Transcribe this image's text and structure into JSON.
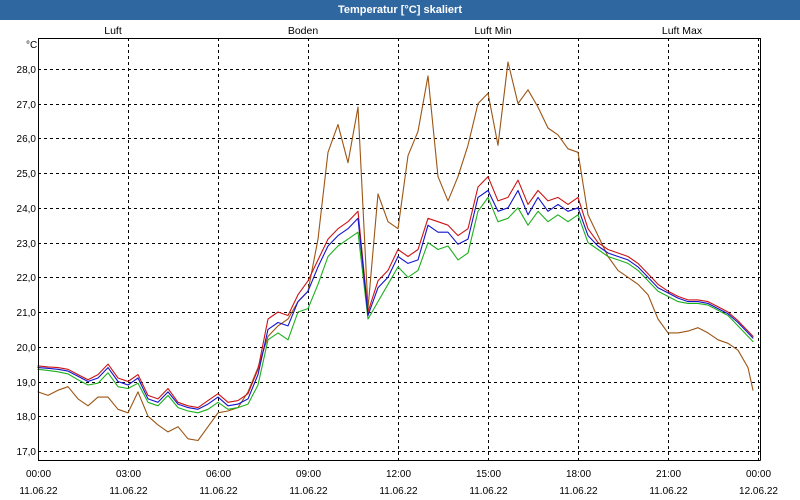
{
  "chart_data": {
    "type": "line",
    "title": "Temperatur [°C] skaliert",
    "ylabel": "°C",
    "ylim": [
      16.74,
      28.89
    ],
    "xlim": [
      "11.06.22 00:00",
      "12.06.22 00:00"
    ],
    "grid": true,
    "legend": "top",
    "yticks": [
      "17,0",
      "18,0",
      "19,0",
      "20,0",
      "21,0",
      "22,0",
      "23,0",
      "24,0",
      "25,0",
      "26,0",
      "27,0",
      "28,0"
    ],
    "xticks": [
      {
        "time": "00:00",
        "date": "11.06.22"
      },
      {
        "time": "03:00",
        "date": "11.06.22"
      },
      {
        "time": "06:00",
        "date": "11.06.22"
      },
      {
        "time": "09:00",
        "date": "11.06.22"
      },
      {
        "time": "12:00",
        "date": "11.06.22"
      },
      {
        "time": "15:00",
        "date": "11.06.22"
      },
      {
        "time": "18:00",
        "date": "11.06.22"
      },
      {
        "time": "21:00",
        "date": "11.06.22"
      },
      {
        "time": "00:00",
        "date": "12.06.22"
      }
    ],
    "x": [
      "11.06.22 00:00",
      "11.06.22 00:20",
      "11.06.22 00:40",
      "11.06.22 01:00",
      "11.06.22 01:20",
      "11.06.22 01:40",
      "11.06.22 02:00",
      "11.06.22 02:20",
      "11.06.22 02:40",
      "11.06.22 03:00",
      "11.06.22 03:20",
      "11.06.22 03:40",
      "11.06.22 04:00",
      "11.06.22 04:20",
      "11.06.22 04:40",
      "11.06.22 05:00",
      "11.06.22 05:20",
      "11.06.22 05:40",
      "11.06.22 06:00",
      "11.06.22 06:20",
      "11.06.22 06:40",
      "11.06.22 07:00",
      "11.06.22 07:20",
      "11.06.22 07:40",
      "11.06.22 08:00",
      "11.06.22 08:20",
      "11.06.22 08:40",
      "11.06.22 09:00",
      "11.06.22 09:20",
      "11.06.22 09:40",
      "11.06.22 10:00",
      "11.06.22 10:20",
      "11.06.22 10:40",
      "11.06.22 11:00",
      "11.06.22 11:20",
      "11.06.22 11:40",
      "11.06.22 12:00",
      "11.06.22 12:20",
      "11.06.22 12:40",
      "11.06.22 13:00",
      "11.06.22 13:20",
      "11.06.22 13:40",
      "11.06.22 14:00",
      "11.06.22 14:20",
      "11.06.22 14:40",
      "11.06.22 15:00",
      "11.06.22 15:20",
      "11.06.22 15:40",
      "11.06.22 16:00",
      "11.06.22 16:20",
      "11.06.22 16:40",
      "11.06.22 17:00",
      "11.06.22 17:20",
      "11.06.22 17:40",
      "11.06.22 18:00",
      "11.06.22 18:20",
      "11.06.22 18:40",
      "11.06.22 19:00",
      "11.06.22 19:20",
      "11.06.22 19:40",
      "11.06.22 20:00",
      "11.06.22 20:20",
      "11.06.22 20:40",
      "11.06.22 21:00",
      "11.06.22 21:20",
      "11.06.22 21:40",
      "11.06.22 22:00",
      "11.06.22 22:20",
      "11.06.22 22:40",
      "11.06.22 23:00",
      "11.06.22 23:20",
      "11.06.22 23:40",
      "11.06.22 23:50"
    ],
    "series": [
      {
        "name": "Luft",
        "color": "#1414cc",
        "values": [
          19.4,
          19.38,
          19.35,
          19.3,
          19.15,
          19.0,
          19.1,
          19.4,
          19.0,
          18.9,
          19.1,
          18.5,
          18.4,
          18.7,
          18.35,
          18.25,
          18.2,
          18.35,
          18.55,
          18.3,
          18.35,
          18.5,
          19.2,
          20.5,
          20.7,
          20.6,
          21.3,
          21.6,
          22.3,
          22.9,
          23.2,
          23.4,
          23.7,
          20.9,
          21.7,
          22.0,
          22.6,
          22.4,
          22.5,
          23.5,
          23.3,
          23.3,
          22.95,
          23.1,
          24.3,
          24.5,
          23.9,
          24.0,
          24.5,
          23.8,
          24.3,
          23.9,
          24.1,
          23.9,
          24.0,
          23.2,
          22.9,
          22.7,
          22.6,
          22.5,
          22.3,
          22.0,
          21.7,
          21.55,
          21.4,
          21.3,
          21.3,
          21.25,
          21.1,
          20.95,
          20.7,
          20.4,
          20.25
        ]
      },
      {
        "name": "Boden",
        "color": "#9c5514",
        "values": [
          18.7,
          18.6,
          18.75,
          18.85,
          18.5,
          18.3,
          18.55,
          18.55,
          18.2,
          18.1,
          18.7,
          18.0,
          17.75,
          17.55,
          17.7,
          17.35,
          17.3,
          17.7,
          18.1,
          18.15,
          18.25,
          18.7,
          19.4,
          20.3,
          20.6,
          20.8,
          21.3,
          21.6,
          23.1,
          25.6,
          26.4,
          25.3,
          26.9,
          21.1,
          24.4,
          23.6,
          23.4,
          25.5,
          26.2,
          27.8,
          24.9,
          24.2,
          24.9,
          25.8,
          27.0,
          27.3,
          25.8,
          28.2,
          27.0,
          27.4,
          26.9,
          26.3,
          26.1,
          25.7,
          25.6,
          23.8,
          23.2,
          22.6,
          22.2,
          22.0,
          21.8,
          21.5,
          20.8,
          20.4,
          20.4,
          20.45,
          20.55,
          20.4,
          20.2,
          20.1,
          19.9,
          19.4,
          18.75
        ]
      },
      {
        "name": "Luft Min",
        "color": "#1cb01c",
        "values": [
          19.35,
          19.32,
          19.28,
          19.22,
          19.05,
          18.9,
          18.95,
          19.25,
          18.85,
          18.8,
          18.95,
          18.4,
          18.3,
          18.6,
          18.25,
          18.15,
          18.1,
          18.2,
          18.4,
          18.2,
          18.25,
          18.35,
          18.9,
          20.2,
          20.4,
          20.2,
          21.0,
          21.1,
          21.8,
          22.6,
          22.9,
          23.1,
          23.3,
          20.8,
          21.3,
          21.8,
          22.3,
          22.0,
          22.2,
          23.0,
          22.8,
          22.9,
          22.5,
          22.7,
          23.9,
          24.3,
          23.6,
          23.7,
          24.0,
          23.5,
          23.9,
          23.6,
          23.8,
          23.6,
          23.8,
          23.0,
          22.8,
          22.6,
          22.5,
          22.4,
          22.2,
          21.9,
          21.6,
          21.45,
          21.3,
          21.25,
          21.25,
          21.2,
          21.05,
          20.9,
          20.6,
          20.3,
          20.15
        ]
      },
      {
        "name": "Luft Max",
        "color": "#cc1414",
        "values": [
          19.45,
          19.42,
          19.4,
          19.35,
          19.2,
          19.05,
          19.2,
          19.5,
          19.1,
          19.0,
          19.2,
          18.6,
          18.5,
          18.8,
          18.4,
          18.3,
          18.25,
          18.45,
          18.65,
          18.4,
          18.45,
          18.65,
          19.35,
          20.8,
          21.0,
          20.9,
          21.5,
          21.9,
          22.5,
          23.1,
          23.4,
          23.6,
          23.9,
          21.0,
          21.9,
          22.2,
          22.8,
          22.6,
          22.8,
          23.7,
          23.6,
          23.5,
          23.2,
          23.4,
          24.6,
          24.9,
          24.2,
          24.3,
          24.8,
          24.1,
          24.5,
          24.2,
          24.3,
          24.1,
          24.3,
          23.4,
          23.0,
          22.8,
          22.7,
          22.6,
          22.4,
          22.1,
          21.8,
          21.6,
          21.45,
          21.35,
          21.35,
          21.3,
          21.15,
          21.0,
          20.75,
          20.45,
          20.3
        ]
      }
    ]
  }
}
